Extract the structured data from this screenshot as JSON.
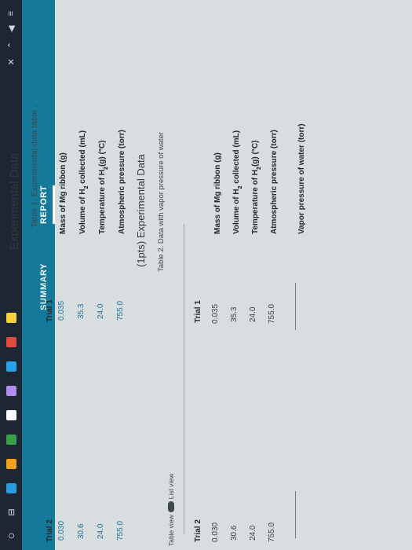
{
  "taskbar": {
    "start_glyph": "○",
    "task_view_glyph": "⊟",
    "tiles": [
      "#2b9be0",
      "#f0a21e",
      "#3a9f4a",
      "#ffffff",
      "#b38cf0",
      "#27a3e8",
      "#e24a3b",
      "#f6d23c"
    ],
    "tray_glyphs": [
      "✕",
      "⌃",
      "◀",
      "≡"
    ]
  },
  "nav": {
    "summary": "SUMMARY",
    "report": "REPORT"
  },
  "section_title": "Experimental Data",
  "table1": {
    "caption": "Table 1. Experimental data table",
    "caption_dot": ".",
    "headers": [
      "Trial 1",
      "Trial 2"
    ],
    "rows": [
      {
        "label_pre": "Mass of Mg ribbon (g)",
        "label_sub": "",
        "label_post": "",
        "values": [
          "0.035",
          "0.030"
        ]
      },
      {
        "label_pre": "Volume of H",
        "label_sub": "2",
        "label_post": " collected (mL)",
        "values": [
          "35.3",
          "30.6"
        ]
      },
      {
        "label_pre": "Temperature of H",
        "label_sub": "2",
        "label_post": "(g) (°C)",
        "values": [
          "24.0",
          "24.0"
        ]
      },
      {
        "label_pre": "Atmospheric pressure (torr)",
        "label_sub": "",
        "label_post": "",
        "values": [
          "755.0",
          "755.0"
        ]
      }
    ]
  },
  "points_title": "(1pts) Experimental Data",
  "table2": {
    "caption": "Table 2. Data with vapor pressure of water",
    "view_toggle": {
      "table_view": "Table view",
      "list_view": "List view"
    },
    "headers": [
      "Trial 1",
      "Trial 2"
    ],
    "rows": [
      {
        "label_pre": "Mass of Mg ribbon (g)",
        "label_sub": "",
        "label_post": "",
        "values": [
          "0.035",
          "0.030"
        ]
      },
      {
        "label_pre": "Volume of H",
        "label_sub": "2",
        "label_post": " collected (mL)",
        "values": [
          "35.3",
          "30.6"
        ]
      },
      {
        "label_pre": "Temperature of H",
        "label_sub": "2",
        "label_post": "(g) (°C)",
        "values": [
          "24.0",
          "24.0"
        ]
      },
      {
        "label_pre": "Atmospheric pressure (torr)",
        "label_sub": "",
        "label_post": "",
        "values": [
          "755.0",
          "755.0"
        ]
      },
      {
        "label_pre": "Vapor pressure of water (torr)",
        "label_sub": "",
        "label_post": "",
        "values": [
          "",
          ""
        ]
      }
    ]
  }
}
